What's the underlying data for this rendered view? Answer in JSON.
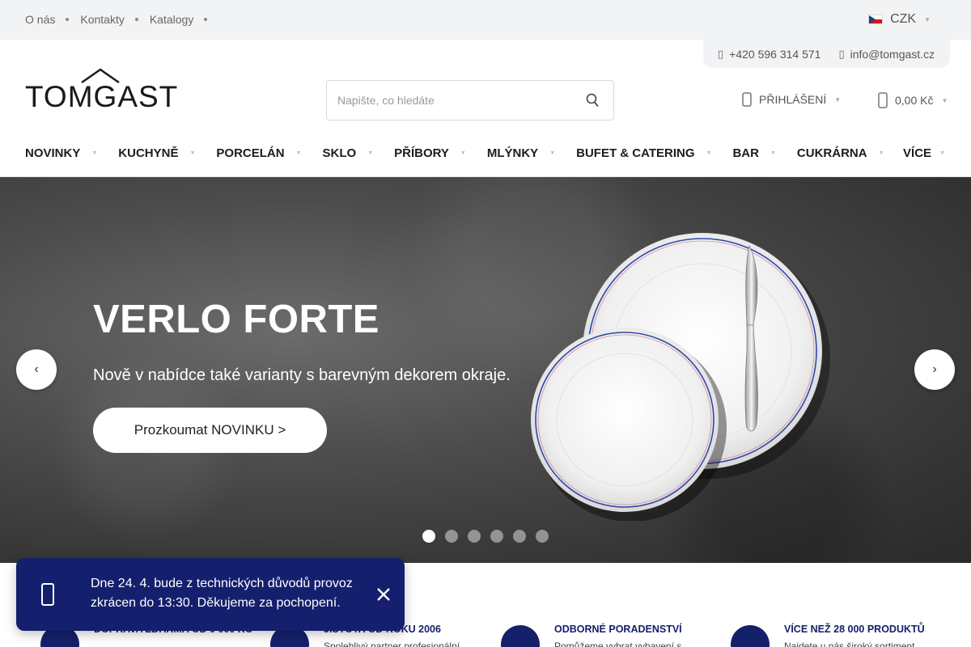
{
  "topbar": {
    "links": [
      "O nás",
      "Kontakty",
      "Katalogy"
    ],
    "currency": "CZK"
  },
  "contact": {
    "phone": "+420 596 314 571",
    "email": "info@tomgast.cz"
  },
  "logo": {
    "text": "TOMGAST"
  },
  "search": {
    "placeholder": "Napište, co hledáte"
  },
  "header": {
    "login_label": "PŘIHLÁŠENÍ",
    "cart_total": "0,00 Kč"
  },
  "nav": {
    "items": [
      "NOVINKY",
      "KUCHYNĚ",
      "PORCELÁN",
      "SKLO",
      "PŘÍBORY",
      "MLÝNKY",
      "BUFET & CATERING",
      "BAR",
      "CUKRÁRNA"
    ],
    "more_label": "VÍCE"
  },
  "hero": {
    "title": "VERLO FORTE",
    "subtitle": "Nově v nabídce také varianty s barevným dekorem okraje.",
    "cta_label": "Prozkoumat NOVINKU >",
    "slides_count": 6,
    "active_slide": 1
  },
  "benefits": [
    {
      "title": "DOPRAVA ZDARMA OD 0 000 KČ",
      "desc": ""
    },
    {
      "title": "JISTOTA OD ROKU 2006",
      "desc": "Spolehlivý partner profesionální"
    },
    {
      "title": "ODBORNÉ PORADENSTVÍ",
      "desc": "Pomůžeme vybrat vybavení s"
    },
    {
      "title": "VÍCE NEŽ 28 000 PRODUKTŮ",
      "desc": "Najdete u nás široký sortiment"
    }
  ],
  "notice": {
    "text": "Dne 24. 4. bude z technických důvodů provoz zkrácen do 13:30. Děkujeme za pochopení."
  },
  "colors": {
    "brand_navy": "#15206b",
    "topbar_bg": "#f2f3f5"
  }
}
